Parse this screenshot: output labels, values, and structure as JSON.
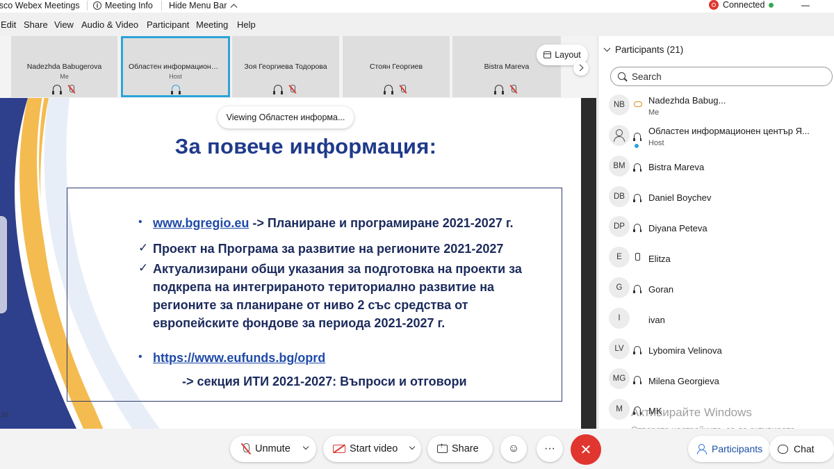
{
  "titlebar": {
    "app_title": "isco Webex Meetings",
    "meeting_info": "Meeting Info",
    "hide_menu": "Hide Menu Bar",
    "status": "Connected"
  },
  "menu": [
    "Edit",
    "Share",
    "View",
    "Audio & Video",
    "Participant",
    "Meeting",
    "Help"
  ],
  "filmstrip": {
    "tiles": [
      {
        "name": "Nadezhda Babugerova",
        "role": "Me"
      },
      {
        "name": "Областен информационен…",
        "role": "Host"
      },
      {
        "name": "Зоя Георгиева Тодорова",
        "role": ""
      },
      {
        "name": "Стоян Георгиев",
        "role": ""
      },
      {
        "name": "Bistra Mareva",
        "role": ""
      }
    ],
    "layout_label": "Layout"
  },
  "slide": {
    "viewing": "Viewing Областен информа...",
    "title": "За повече информация:",
    "line1_link": "www.bgregio.eu",
    "line1_rest": " -> Планиране и програмиране 2021-2027 г.",
    "line2": "Проект на Програма за развитие на регионите 2021-2027",
    "line3": [
      "Актуализирани общи указания за подготовка на проекти за",
      "подкрепа на интегрираното териториално развитие на",
      "регионите за планиране от ниво 2 със средства от",
      "европейските фондове за периода 2021-2027 г."
    ],
    "line4_link": "https://www.eufunds.bg/oprd",
    "line5": "-> секция ИТИ 2021-2027: Въпроси и отговори",
    "page_number": "10"
  },
  "participants_panel": {
    "header": "Participants (21)",
    "search_placeholder": "Search",
    "people": [
      {
        "initials": "NB",
        "name": "Nadezhda Babug...",
        "role": "Me",
        "audio": "cloud"
      },
      {
        "initials": "",
        "name": "Областен информационен център Я...",
        "role": "Host",
        "audio": "headset"
      },
      {
        "initials": "BM",
        "name": "Bistra Mareva",
        "role": "",
        "audio": "headset"
      },
      {
        "initials": "DB",
        "name": "Daniel Boychev",
        "role": "",
        "audio": "headset"
      },
      {
        "initials": "DP",
        "name": "Diyana Peteva",
        "role": "",
        "audio": "headset"
      },
      {
        "initials": "E",
        "name": "Elitza",
        "role": "",
        "audio": "phone"
      },
      {
        "initials": "G",
        "name": "Goran",
        "role": "",
        "audio": "headset"
      },
      {
        "initials": "I",
        "name": "ivan",
        "role": "",
        "audio": "none"
      },
      {
        "initials": "LV",
        "name": "Lybomira Velinova",
        "role": "",
        "audio": "headset"
      },
      {
        "initials": "MG",
        "name": "Milena Georgieva",
        "role": "",
        "audio": "headset"
      },
      {
        "initials": "M",
        "name": "MK",
        "role": "",
        "audio": "headset"
      }
    ]
  },
  "watermark": {
    "title": "Активирайте Windows",
    "text": "Отворете настройките, за да активирате Windows."
  },
  "controls": {
    "unmute": "Unmute",
    "start_video": "Start video",
    "share": "Share",
    "reactions": "☺",
    "more": "···",
    "end": "✕",
    "participants_tab": "Participants",
    "chat_tab": "Chat"
  },
  "colors": {
    "accent": "#2aa4d9",
    "slide_title": "#1f3a8a",
    "end_red": "#e0362f"
  }
}
